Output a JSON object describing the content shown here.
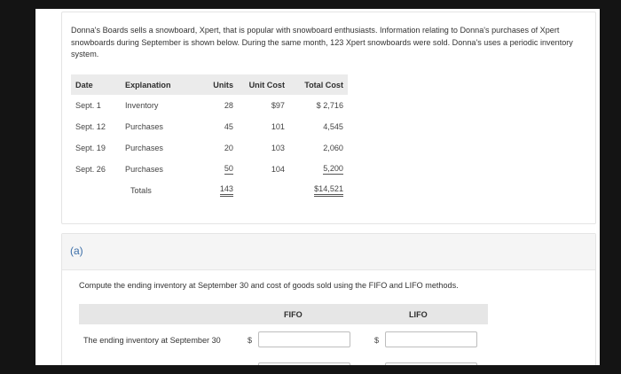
{
  "problem": {
    "intro": "Donna's Boards sells a snowboard, Xpert, that is popular with snowboard enthusiasts. Information relating to Donna's purchases of Xpert snowboards during September is shown below. During the same month, 123 Xpert snowboards were sold. Donna's uses a periodic inventory system.",
    "table": {
      "headers": [
        "Date",
        "Explanation",
        "Units",
        "Unit Cost",
        "Total Cost"
      ],
      "rows": [
        {
          "date": "Sept. 1",
          "explanation": "Inventory",
          "units": "28",
          "unit_cost": "$97",
          "total_cost": "$ 2,716"
        },
        {
          "date": "Sept. 12",
          "explanation": "Purchases",
          "units": "45",
          "unit_cost": "101",
          "total_cost": "4,545"
        },
        {
          "date": "Sept. 19",
          "explanation": "Purchases",
          "units": "20",
          "unit_cost": "103",
          "total_cost": "2,060"
        },
        {
          "date": "Sept. 26",
          "explanation": "Purchases",
          "units": "50",
          "unit_cost": "104",
          "total_cost": "5,200"
        }
      ],
      "totals": {
        "label": "Totals",
        "units": "143",
        "total_cost": "$14,521"
      }
    }
  },
  "part_a": {
    "label": "(a)",
    "instructions": "Compute the ending inventory at September 30 and cost of goods sold using the FIFO and LIFO methods.",
    "columns": {
      "fifo": "FIFO",
      "lifo": "LIFO"
    },
    "ending_inventory": {
      "label": "The ending inventory at September 30",
      "currency": "$",
      "fifo_value": "",
      "lifo_value": ""
    }
  }
}
